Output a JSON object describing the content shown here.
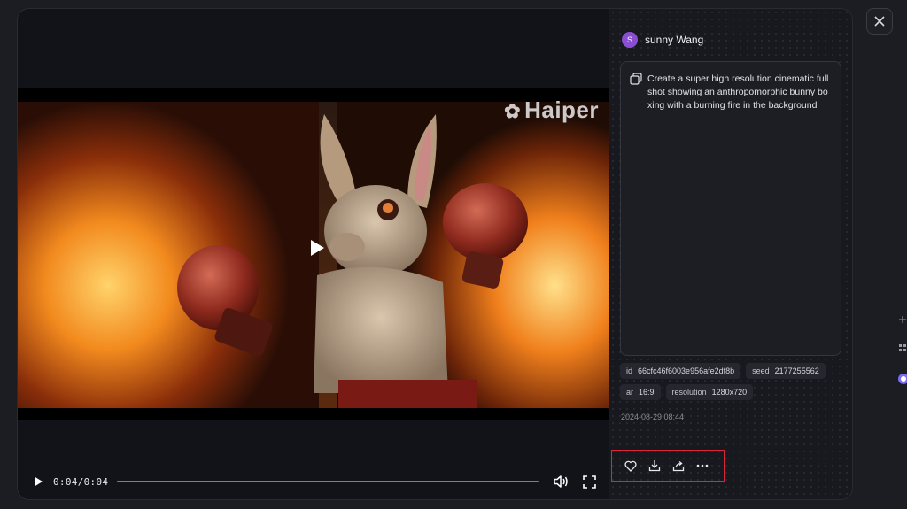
{
  "video": {
    "watermark": "Haiper",
    "time_display": "0:04/0:04",
    "progress": 1.0
  },
  "user": {
    "avatar_initial": "S",
    "name": "sunny Wang"
  },
  "prompt": {
    "text": "Create a super high resolution cinematic full shot showing an anthropomorphic bunny bo xing with a burning fire in the background"
  },
  "tags": [
    {
      "key": "id",
      "value": "66cfc46f6003e956afe2df8b"
    },
    {
      "key": "seed",
      "value": "2177255562"
    },
    {
      "key": "ar",
      "value": "16:9"
    },
    {
      "key": "resolution",
      "value": "1280x720"
    }
  ],
  "created_at": "2024-08-29 08:44",
  "icons": {
    "play": "play-icon",
    "volume": "volume-icon",
    "fullscreen": "fullscreen-icon",
    "copy": "copy-icon",
    "like": "heart-icon",
    "download": "download-icon",
    "share": "share-icon",
    "more": "more-icon",
    "close": "close-icon"
  },
  "colors": {
    "accent": "#7b6cf0",
    "avatar": "#8a4fd1",
    "highlight": "#d8263a"
  }
}
